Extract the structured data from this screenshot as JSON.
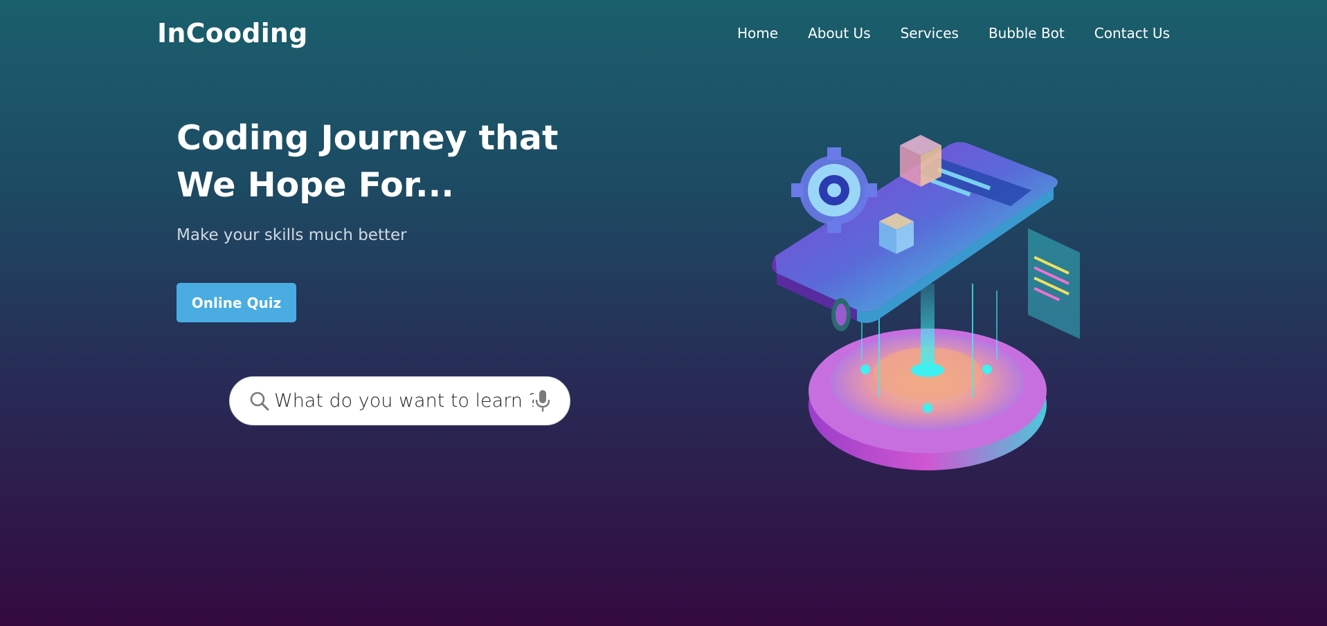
{
  "brand": {
    "logo": "InCooding"
  },
  "nav": {
    "items": [
      "Home",
      "About Us",
      "Services",
      "Bubble Bot",
      "Contact Us"
    ]
  },
  "hero": {
    "title": "Coding Journey that We Hope For...",
    "subtitle": "Make your skills much better",
    "button_label": "Online Quiz"
  },
  "search": {
    "placeholder": "What do you want to learn ?"
  },
  "icons": {
    "search": "search-icon",
    "mic": "mic-icon",
    "illustration": "isometric-coding-illustration"
  },
  "colors": {
    "accent": "#4aace0",
    "bg_top": "#1a5f6c",
    "bg_bottom": "#330a40"
  }
}
